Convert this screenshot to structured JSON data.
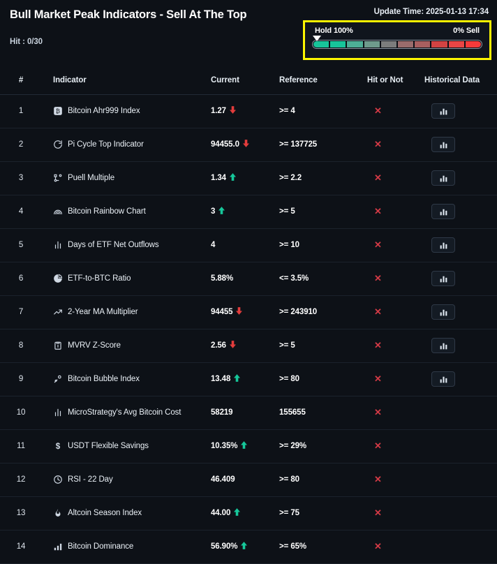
{
  "header": {
    "title": "Bull Market Peak Indicators - Sell At The Top",
    "update_time": "Update Time: 2025-01-13 17:34",
    "hit_count": "Hit : 0/30"
  },
  "gauge": {
    "left_label": "Hold 100%",
    "right_label": "0% Sell",
    "pointer_percent": 3,
    "segment_colors": [
      "#17c49a",
      "#17c49a",
      "#4dae96",
      "#6e9a8c",
      "#7c7d7d",
      "#9a6c6c",
      "#a85f5f",
      "#d34343",
      "#e84545",
      "#f53a3a"
    ],
    "highlight_color": "#fcf500"
  },
  "table": {
    "columns": [
      "#",
      "Indicator",
      "Current",
      "Reference",
      "Hit or Not",
      "Historical Data"
    ],
    "rows": [
      {
        "num": "1",
        "icon": "bitcoin-badge-icon",
        "name": "Bitcoin Ahr999 Index",
        "current": "1.27",
        "trend": "down",
        "reference": ">= 4",
        "hit": "✕",
        "history": true
      },
      {
        "num": "2",
        "icon": "refresh-cycle-icon",
        "name": "Pi Cycle Top Indicator",
        "current": "94455.0",
        "trend": "down",
        "reference": ">= 137725",
        "hit": "✕",
        "history": true
      },
      {
        "num": "3",
        "icon": "network-node-icon",
        "name": "Puell Multiple",
        "current": "1.34",
        "trend": "up",
        "reference": ">= 2.2",
        "hit": "✕",
        "history": true
      },
      {
        "num": "4",
        "icon": "rainbow-icon",
        "name": "Bitcoin Rainbow Chart",
        "current": "3",
        "trend": "up",
        "reference": ">= 5",
        "hit": "✕",
        "history": true
      },
      {
        "num": "5",
        "icon": "bar-chart-icon",
        "name": "Days of ETF Net Outflows",
        "current": "4",
        "trend": "none",
        "reference": ">= 10",
        "hit": "✕",
        "history": true
      },
      {
        "num": "6",
        "icon": "pie-chart-icon",
        "name": "ETF-to-BTC Ratio",
        "current": "5.88%",
        "trend": "none",
        "reference": "<= 3.5%",
        "hit": "✕",
        "history": true
      },
      {
        "num": "7",
        "icon": "trending-up-icon",
        "name": "2-Year MA Multiplier",
        "current": "94455",
        "trend": "down",
        "reference": ">= 243910",
        "hit": "✕",
        "history": true
      },
      {
        "num": "8",
        "icon": "clipboard-icon",
        "name": "MVRV Z-Score",
        "current": "2.56",
        "trend": "down",
        "reference": ">= 5",
        "hit": "✕",
        "history": true
      },
      {
        "num": "9",
        "icon": "bubble-scatter-icon",
        "name": "Bitcoin Bubble Index",
        "current": "13.48",
        "trend": "up",
        "reference": ">= 80",
        "hit": "✕",
        "history": true
      },
      {
        "num": "10",
        "icon": "bar-chart-icon",
        "name": "MicroStrategy's Avg Bitcoin Cost",
        "current": "58219",
        "trend": "none",
        "reference": "155655",
        "hit": "✕",
        "history": false
      },
      {
        "num": "11",
        "icon": "dollar-icon",
        "name": "USDT Flexible Savings",
        "current": "10.35%",
        "trend": "up",
        "reference": ">= 29%",
        "hit": "✕",
        "history": false
      },
      {
        "num": "12",
        "icon": "clock-icon",
        "name": "RSI - 22 Day",
        "current": "46.409",
        "trend": "none",
        "reference": ">= 80",
        "hit": "✕",
        "history": false
      },
      {
        "num": "13",
        "icon": "flame-icon",
        "name": "Altcoin Season Index",
        "current": "44.00",
        "trend": "up",
        "reference": ">= 75",
        "hit": "✕",
        "history": false
      },
      {
        "num": "14",
        "icon": "chart-growth-icon",
        "name": "Bitcoin Dominance",
        "current": "56.90%",
        "trend": "up",
        "reference": ">= 65%",
        "hit": "✕",
        "history": false
      }
    ]
  }
}
